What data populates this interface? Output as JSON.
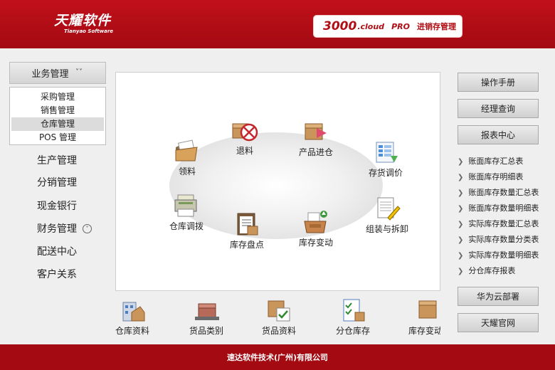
{
  "header": {
    "logo_cn": "天耀软件",
    "logo_en": "Tianyao Software",
    "product_num": "3000",
    "product_cloud": ".cloud",
    "product_pro": "PRO",
    "product_name": "进销存管理"
  },
  "sidebar": {
    "business": "业务管理",
    "sub_items": [
      "采购管理",
      "销售管理",
      "仓库管理",
      "POS 管理"
    ],
    "active_sub": 2,
    "items": [
      "生产管理",
      "分销管理",
      "现金银行",
      "财务管理",
      "配送中心",
      "客户关系"
    ]
  },
  "main": {
    "nodes": {
      "tuiliao": "退料",
      "chanpin": "产品进仓",
      "lingliao": "领料",
      "cunhuo": "存货调价",
      "diaobo": "仓库调拨",
      "pandian": "库存盘点",
      "biandong": "库存变动",
      "zuzhuang": "组装与拆卸"
    }
  },
  "bottom_strip": [
    "仓库资料",
    "货品类别",
    "货品资料",
    "分仓库存",
    "库存变动"
  ],
  "right": {
    "manual": "操作手册",
    "manager": "经理查询",
    "reports": "报表中心",
    "links": [
      "账面库存汇总表",
      "账面库存明细表",
      "账面库存数量汇总表",
      "账面库存数量明细表",
      "实际库存数量汇总表",
      "实际库存数量分类表",
      "实际库存数量明细表",
      "分仓库存报表"
    ],
    "huawei": "华为云部署",
    "official": "天耀官网"
  },
  "footer": {
    "company": "速达软件技术(广州)有限公司"
  },
  "colors": {
    "brand_red": "#a30a12",
    "header_red": "#c1101b"
  }
}
